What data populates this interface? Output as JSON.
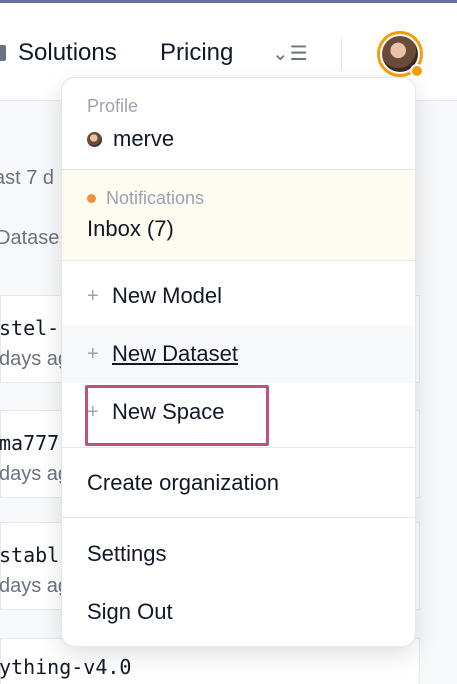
{
  "header": {
    "nav": {
      "solutions_label": "Solutions",
      "pricing_label": "Pricing",
      "more_label": "⌄☰"
    },
    "avatar": {
      "status_color": "#f59e0b"
    }
  },
  "background": {
    "fragments": {
      "activity": "ast 7 d",
      "datasets": "Datase",
      "item1_name": "stel-",
      "item1_time": "days ag",
      "item2_name": "ma777",
      "item2_time": "days ag",
      "item3_name": "stabl",
      "item3_time": "days ag",
      "item4_name": "ything-v4.0"
    }
  },
  "dropdown": {
    "profile": {
      "label": "Profile",
      "username": "merve"
    },
    "notifications": {
      "label": "Notifications",
      "inbox": "Inbox (7)",
      "dot_color": "#f0913a"
    },
    "new_items": {
      "plus_glyph": "+",
      "new_model": "New Model",
      "new_dataset": "New Dataset",
      "new_space": "New Space"
    },
    "create_org": "Create organization",
    "settings": "Settings",
    "sign_out": "Sign Out"
  },
  "colors": {
    "highlight": "#c0507d",
    "accent": "#f59e0b"
  }
}
